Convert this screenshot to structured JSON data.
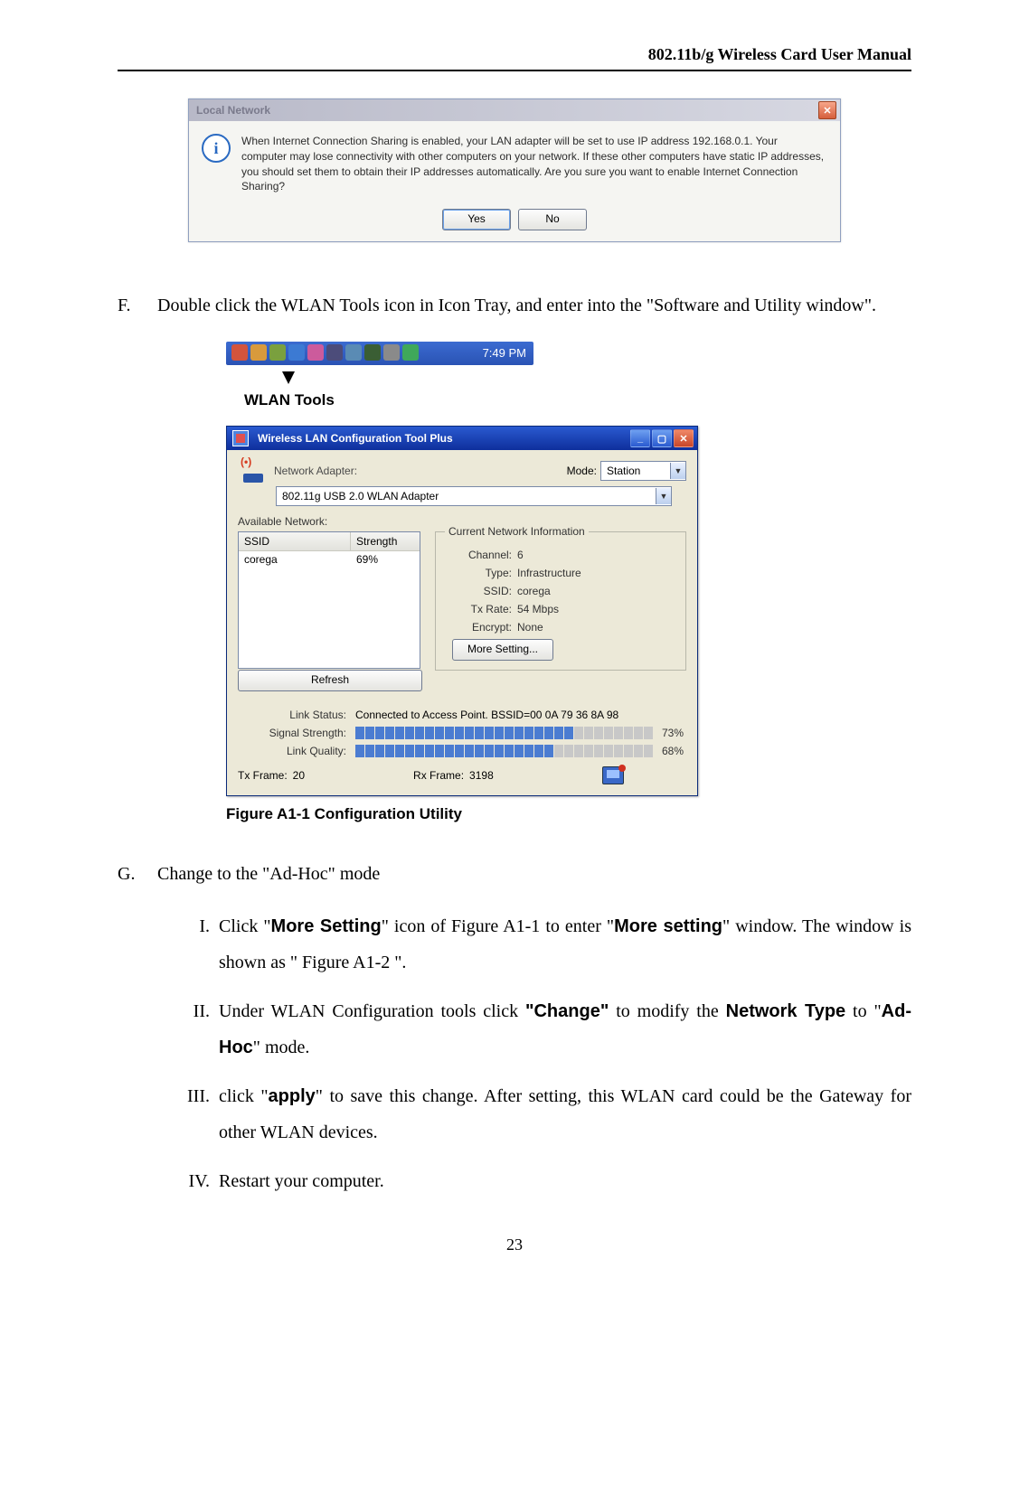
{
  "header": "802.11b/g Wireless Card User Manual",
  "dialog1": {
    "title": "Local Network",
    "msg": "When Internet Connection Sharing is enabled, your LAN adapter will be set to use IP address 192.168.0.1. Your computer may lose connectivity with other computers on your network. If these other computers have static IP addresses, you should set them to obtain their IP addresses automatically.  Are you sure you want to enable Internet Connection Sharing?",
    "yes": "Yes",
    "no": "No"
  },
  "paraF": {
    "label": "F.",
    "text": "Double click the WLAN Tools icon in Icon Tray, and enter into the \"Software and Utility window\"."
  },
  "taskbar": {
    "time": "7:49 PM",
    "caption": "WLAN Tools"
  },
  "wlan": {
    "title": "Wireless LAN Configuration Tool Plus",
    "na_label": "Network Adapter:",
    "mode_label": "Mode:",
    "mode_value": "Station",
    "adapter": "802.11g USB 2.0 WLAN Adapter",
    "avail_label": "Available Network:",
    "cols": {
      "ssid": "SSID",
      "strength": "Strength"
    },
    "rows": [
      {
        "ssid": "corega",
        "strength": "69%"
      }
    ],
    "refresh": "Refresh",
    "group_title": "Current Network Information",
    "kv": {
      "channel_k": "Channel:",
      "channel_v": "6",
      "type_k": "Type:",
      "type_v": "Infrastructure",
      "ssid_k": "SSID:",
      "ssid_v": "corega",
      "txrate_k": "Tx Rate:",
      "txrate_v": "54 Mbps",
      "encrypt_k": "Encrypt:",
      "encrypt_v": "None"
    },
    "more_setting": "More Setting...",
    "link_status_k": "Link Status:",
    "link_status_v": "Connected to Access Point. BSSID=00 0A 79 36 8A 98",
    "sig_k": "Signal Strength:",
    "sig_pct": "73%",
    "lq_k": "Link Quality:",
    "lq_pct": "68%",
    "txframe_k": "Tx Frame:",
    "txframe_v": "20",
    "rxframe_k": "Rx Frame:",
    "rxframe_v": "3198"
  },
  "figA1": "Figure A1-1 Configuration Utility",
  "paraG": {
    "label": "G.",
    "text": "Change to the \"Ad-Hoc\" mode"
  },
  "roman": {
    "i": {
      "label": "I.",
      "t1": "Click \"",
      "b1": "More Setting",
      "t2": "\" icon of Figure A1-1 to enter \"",
      "b2": "More setting",
      "t3": "\" window. The window is shown as \" Figure A1-2 \"."
    },
    "ii": {
      "label": "II.",
      "t1": "Under WLAN Configuration tools click ",
      "b1": "\"Change\"",
      "t2": " to modify the ",
      "b2": "Network Type",
      "t3": " to \"",
      "b3": "Ad-Hoc",
      "t4": "\" mode."
    },
    "iii": {
      "label": "III.",
      "t1": "click \"",
      "b1": "apply",
      "t2": "\" to save this change. After setting, this WLAN card could be the Gateway for other WLAN devices."
    },
    "iv": {
      "label": "IV.",
      "t1": "Restart your computer."
    }
  },
  "page_no": "23"
}
